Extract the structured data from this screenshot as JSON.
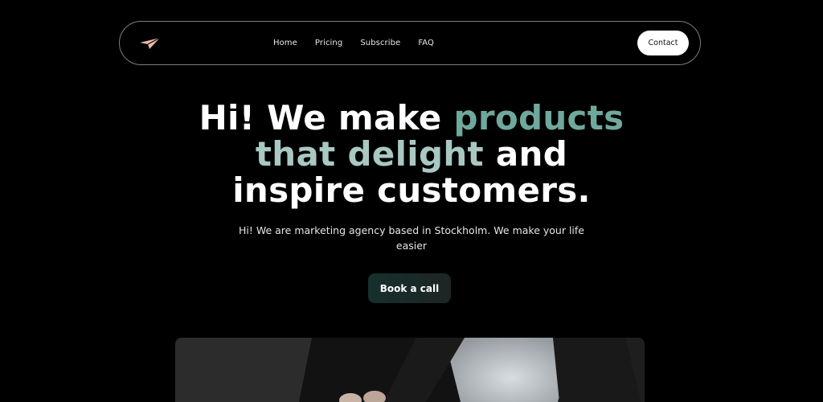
{
  "nav": {
    "logo_icon": "paper-plane-icon",
    "links": [
      "Home",
      "Pricing",
      "Subscribe",
      "FAQ"
    ],
    "contact_label": "Contact"
  },
  "hero": {
    "line1_plain": "Hi! We make ",
    "line1_accent": "products",
    "line2_accent": "that delight",
    "line2_plain": " and",
    "line3_plain": "inspire customers.",
    "subtitle": "Hi! We are marketing agency based in Stockholm. We make your life easier",
    "cta_label": "Book a call"
  },
  "colors": {
    "background": "#000000",
    "accent_green": "#6fa89d",
    "accent_light": "#a9c8c3",
    "logo": "#e9b9a6"
  }
}
